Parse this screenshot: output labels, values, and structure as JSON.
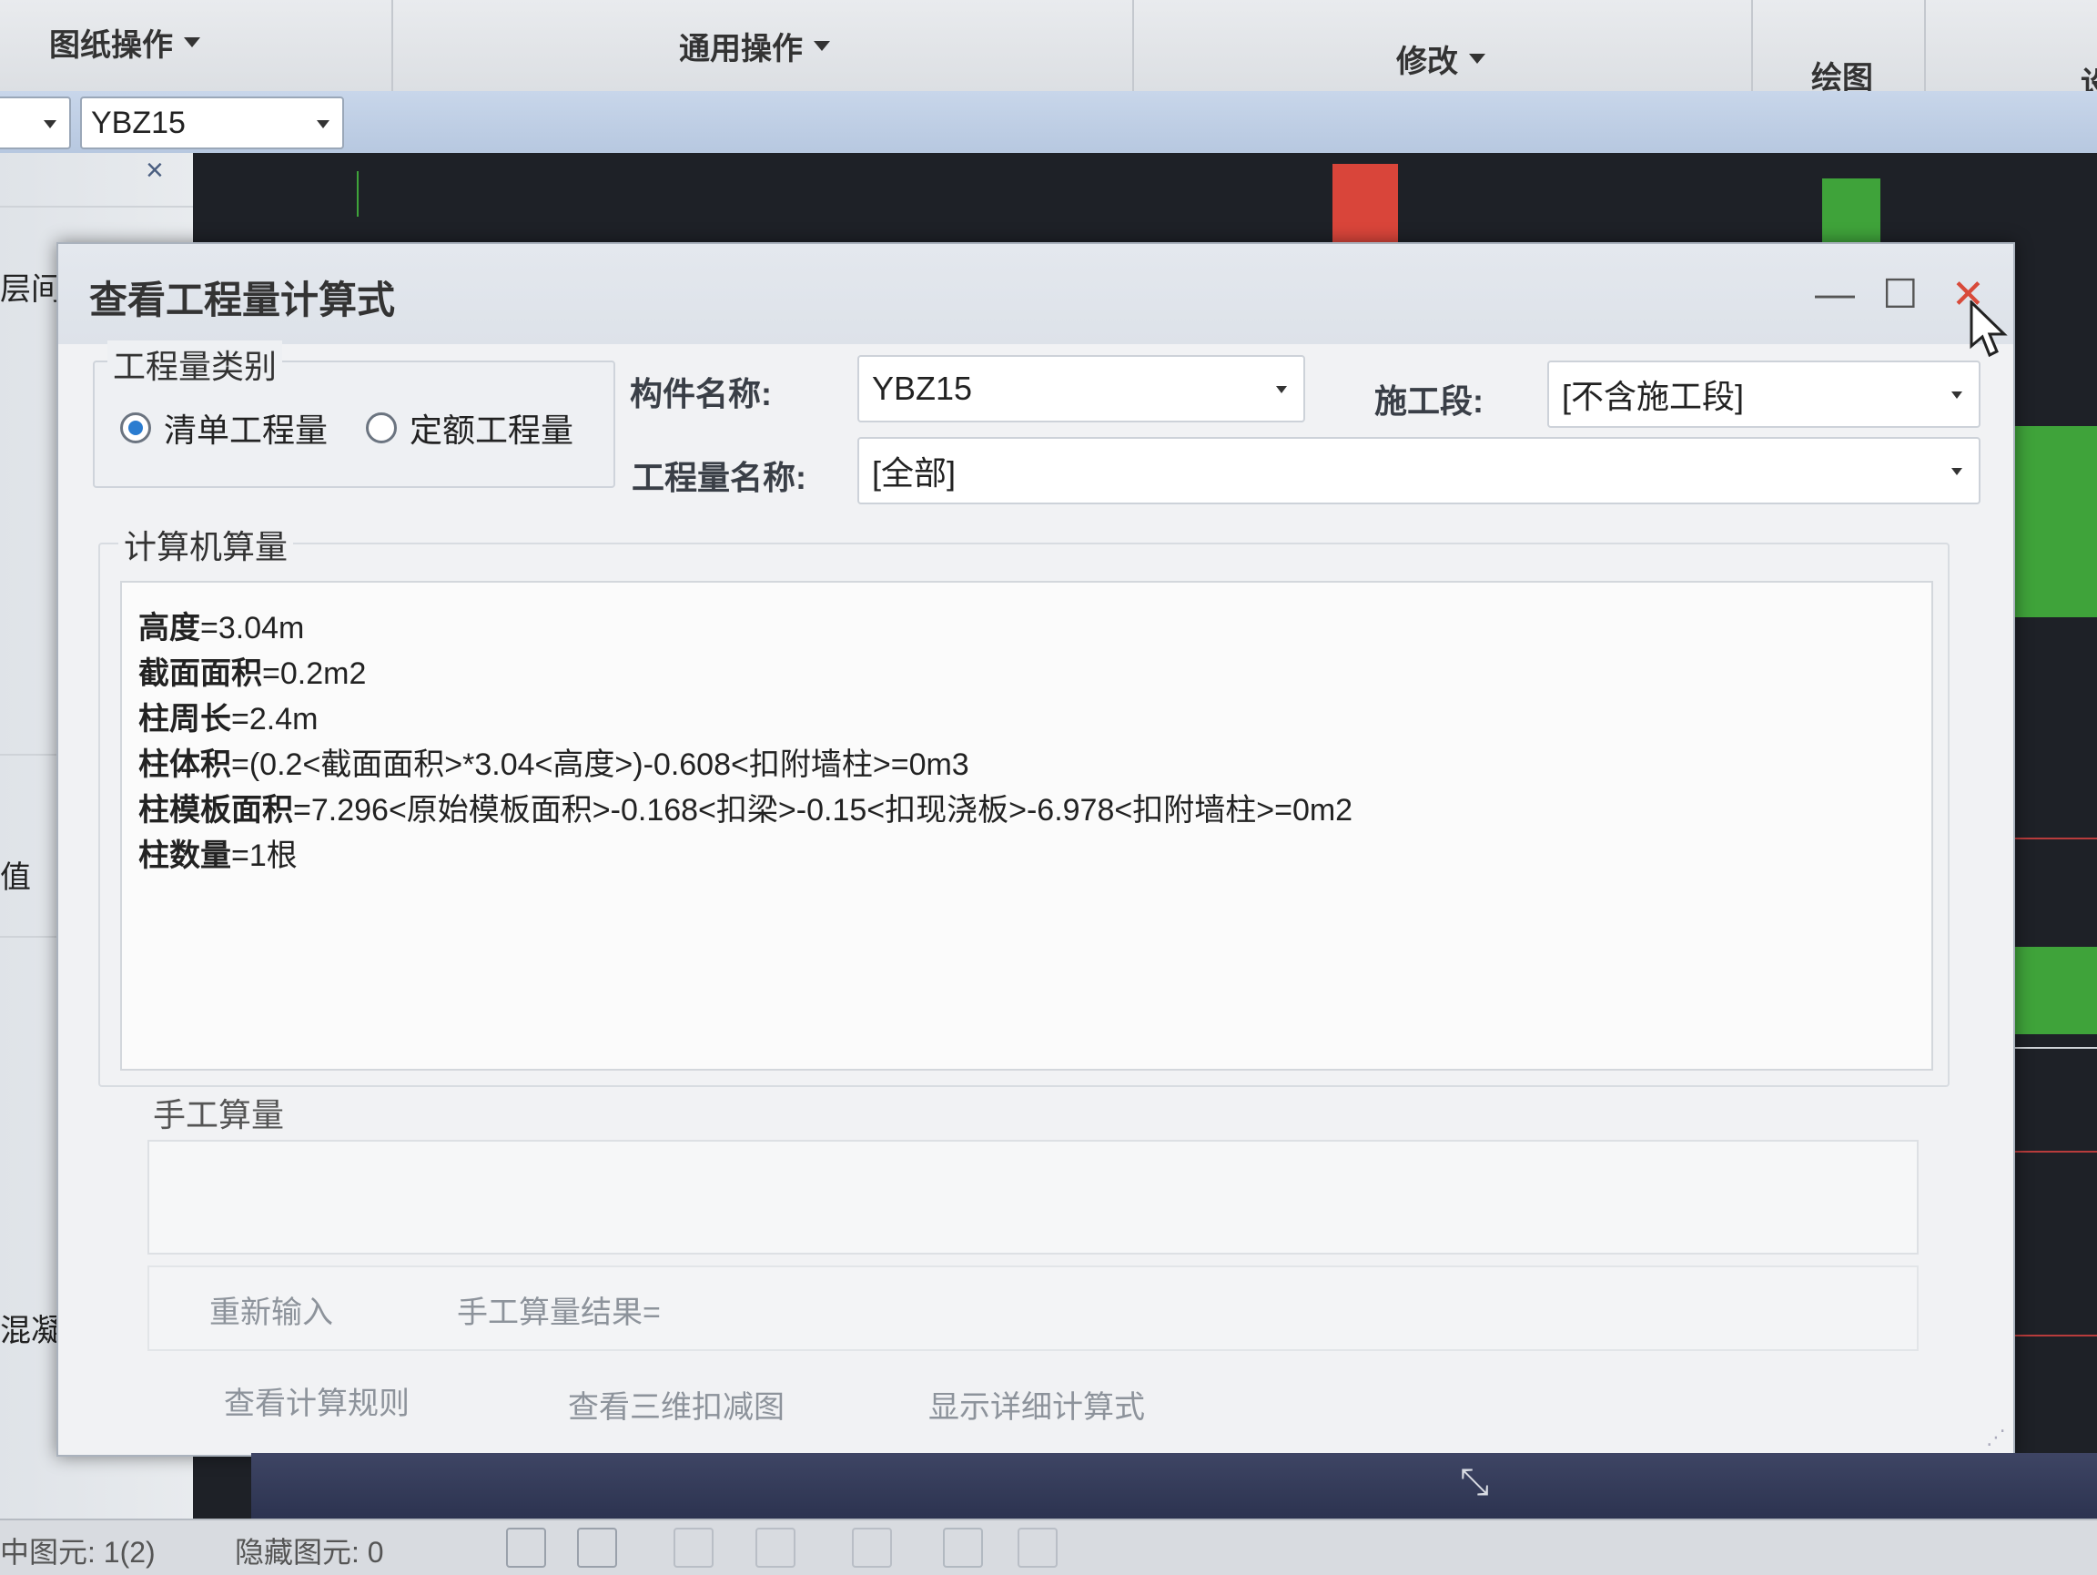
{
  "ribbon": {
    "groups": [
      {
        "label": "图纸操作"
      },
      {
        "label": "通用操作"
      },
      {
        "label": "修改"
      },
      {
        "label": "绘图"
      }
    ],
    "partial_right": "设"
  },
  "toolbar": {
    "layer_combo_value": "",
    "component_combo_value": "YBZ15"
  },
  "left_panel": {
    "close_glyph": "×",
    "frag1": "层间",
    "frag2": "值",
    "frag3": "混凝土)"
  },
  "dialog": {
    "title": "查看工程量计算式",
    "minimize": "—",
    "maximize": "☐",
    "close": "✕",
    "quantity_type": {
      "legend": "工程量类别",
      "options": [
        "清单工程量",
        "定额工程量"
      ],
      "selected": "清单工程量"
    },
    "component_name_label": "构件名称:",
    "component_name_value": "YBZ15",
    "segment_label": "施工段:",
    "segment_value": "[不含施工段]",
    "quantity_name_label": "工程量名称:",
    "quantity_name_value": "[全部]",
    "computer_calc": {
      "legend": "计算机算量",
      "lines": [
        {
          "name": "高度",
          "expr": "=3.04m"
        },
        {
          "name": "截面面积",
          "expr": "=0.2m2"
        },
        {
          "name": "柱周长",
          "expr": "=2.4m"
        },
        {
          "name": "柱体积",
          "expr": "=(0.2<截面面积>*3.04<高度>)-0.608<扣附墙柱>=0m3"
        },
        {
          "name": "柱模板面积",
          "expr": "=7.296<原始模板面积>-0.168<扣梁>-0.15<扣现浇板>-6.978<扣附墙柱>=0m2"
        },
        {
          "name": "柱数量",
          "expr": "=1根"
        }
      ]
    },
    "manual_calc": {
      "legend": "手工算量",
      "reenter_button": "重新输入",
      "result_label": "手工算量结果="
    },
    "buttons": {
      "view_rules": "查看计算规则",
      "view_3d": "查看三维扣减图",
      "show_detail": "显示详细计算式"
    }
  },
  "status_bar": {
    "selected": "中图元: 1(2)",
    "hidden": "隐藏图元: 0"
  },
  "colors": {
    "cad_background": "#1e2127",
    "column_red": "#d9453a",
    "column_green": "#3fa33a",
    "radio_selected": "#2a7cd0"
  }
}
